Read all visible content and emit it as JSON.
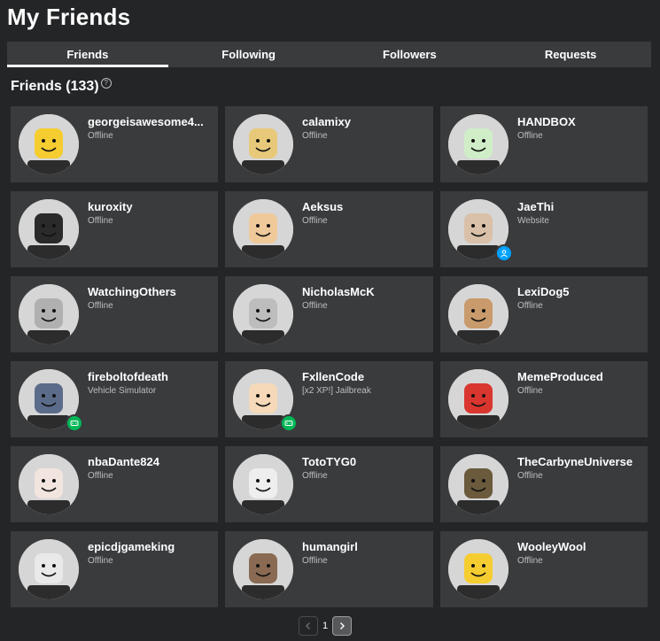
{
  "page": {
    "title": "My Friends"
  },
  "tabs": [
    {
      "label": "Friends",
      "active": true
    },
    {
      "label": "Following",
      "active": false
    },
    {
      "label": "Followers",
      "active": false
    },
    {
      "label": "Requests",
      "active": false
    }
  ],
  "section": {
    "title": "Friends (133)",
    "help_icon": "question-circle-icon"
  },
  "friends": [
    {
      "name": "georgeisawesome4...",
      "status": "Offline",
      "badge": null,
      "avatar_bg": "#d6d6d6",
      "skin": "#f5cd30"
    },
    {
      "name": "calamixy",
      "status": "Offline",
      "badge": null,
      "avatar_bg": "#d6d6d6",
      "skin": "#e8c97a"
    },
    {
      "name": "HANDBOX",
      "status": "Offline",
      "badge": null,
      "avatar_bg": "#d6d6d6",
      "skin": "#cfeec8"
    },
    {
      "name": "kuroxity",
      "status": "Offline",
      "badge": null,
      "avatar_bg": "#d6d6d6",
      "skin": "#2a2a2a"
    },
    {
      "name": "Aeksus",
      "status": "Offline",
      "badge": null,
      "avatar_bg": "#d6d6d6",
      "skin": "#f0c99a"
    },
    {
      "name": "JaeThi",
      "status": "Website",
      "badge": "web",
      "avatar_bg": "#d6d6d6",
      "skin": "#d9c0a8"
    },
    {
      "name": "WatchingOthers",
      "status": "Offline",
      "badge": null,
      "avatar_bg": "#d6d6d6",
      "skin": "#b0b0b0"
    },
    {
      "name": "NicholasMcK",
      "status": "Offline",
      "badge": null,
      "avatar_bg": "#d6d6d6",
      "skin": "#bdbdbd"
    },
    {
      "name": "LexiDog5",
      "status": "Offline",
      "badge": null,
      "avatar_bg": "#d6d6d6",
      "skin": "#c99a6b"
    },
    {
      "name": "fireboltofdeath",
      "status": "Vehicle Simulator",
      "badge": "game",
      "avatar_bg": "#d6d6d6",
      "skin": "#5b6b8a"
    },
    {
      "name": "FxllenCode",
      "status": "[x2 XP!] Jailbreak",
      "badge": "game",
      "avatar_bg": "#d6d6d6",
      "skin": "#f5d9b8"
    },
    {
      "name": "MemeProduced",
      "status": "Offline",
      "badge": null,
      "avatar_bg": "#d6d6d6",
      "skin": "#d9362f"
    },
    {
      "name": "nbaDante824",
      "status": "Offline",
      "badge": null,
      "avatar_bg": "#d6d6d6",
      "skin": "#f2e4df"
    },
    {
      "name": "TotoTYG0",
      "status": "Offline",
      "badge": null,
      "avatar_bg": "#d6d6d6",
      "skin": "#eeeeee"
    },
    {
      "name": "TheCarbyneUniverse",
      "status": "Offline",
      "badge": null,
      "avatar_bg": "#d6d6d6",
      "skin": "#6b5a3c"
    },
    {
      "name": "epicdjgameking",
      "status": "Offline",
      "badge": null,
      "avatar_bg": "#d6d6d6",
      "skin": "#e9e9e9"
    },
    {
      "name": "humangirl",
      "status": "Offline",
      "badge": null,
      "avatar_bg": "#d6d6d6",
      "skin": "#8a6a52"
    },
    {
      "name": "WooleyWool",
      "status": "Offline",
      "badge": null,
      "avatar_bg": "#d6d6d6",
      "skin": "#f5cd30"
    }
  ],
  "pagination": {
    "current_page": "1",
    "prev_icon": "chevron-left-icon",
    "next_icon": "chevron-right-icon"
  },
  "colors": {
    "background": "#232527",
    "card": "#393b3d",
    "status_text": "#bdbebe",
    "game_badge": "#02b757",
    "web_badge": "#00a2ff"
  }
}
